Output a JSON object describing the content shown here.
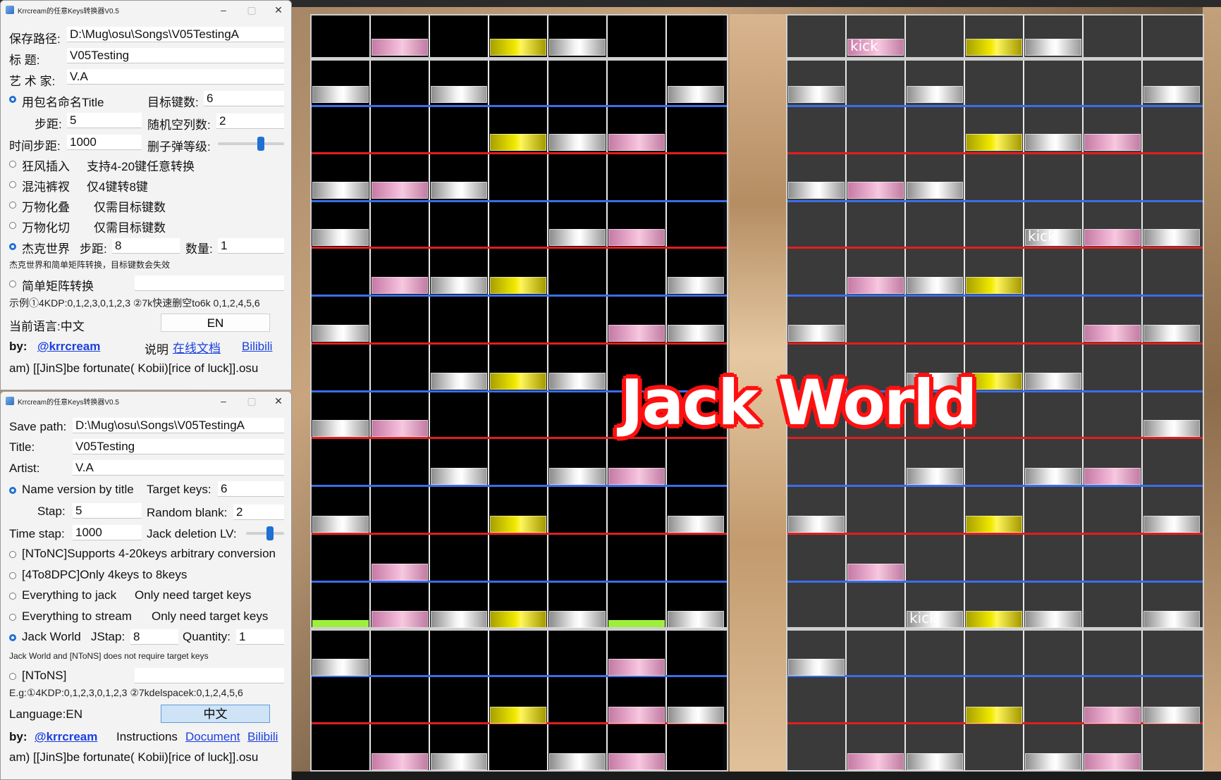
{
  "overlay_text": "Jack World",
  "kick_labels": [
    "kick",
    "kick",
    "kick"
  ],
  "colors": {
    "accent": "#1f6fd4",
    "note_white": "#f4f4f4",
    "note_pink": "#f1b7d6",
    "note_yellow": "#f2ea00",
    "note_green": "#9cf03a",
    "line_blue": "#3a6ee8",
    "line_red": "#e11f1f",
    "overlay_stroke": "#ff1010"
  },
  "cn_window": {
    "title": "Krrcream的任意Keys转换器V0.5",
    "save_path_label": "保存路径:",
    "save_path_value": "D:\\Mug\\osu\\Songs\\V05TestingA",
    "title_label": "标    题:",
    "title_value": "V05Testing",
    "artist_label": "艺 术 家:",
    "artist_value": "V.A",
    "name_by_title": "用包名命名Title",
    "target_keys_label": "目标键数:",
    "target_keys_value": "6",
    "step_label": "步距:",
    "step_value": "5",
    "random_blank_label": "随机空列数:",
    "random_blank_value": "2",
    "time_step_label": "时间步距:",
    "time_step_value": "1000",
    "jack_del_label": "删子弹等级:",
    "opt1": "狂风插入",
    "opt1_desc": "支持4-20键任意转换",
    "opt2": "混沌裤衩",
    "opt2_desc": "仅4键转8键",
    "opt3": "万物化叠",
    "opt3_desc": "仅需目标键数",
    "opt4": "万物化切",
    "opt4_desc": "仅需目标键数",
    "opt5": "杰克世界",
    "jstep_label": "步距:",
    "jstep_value": "8",
    "qty_label": "数量:",
    "qty_value": "1",
    "note_small": "杰克世界和简单矩阵转换，目标键数会失效",
    "opt6": "简单矩阵转换",
    "example": "示例①4KDP:0,1,2,3,0,1,2,3 ②7k快速删空to6k 0,1,2,4,5,6",
    "language": "当前语言:中文",
    "lang_button": "EN",
    "by_label": "by:",
    "author_link": "@krrcream",
    "instr_label": "说明",
    "doc_link": "在线文档",
    "bili_link": "Bilibili",
    "file": "am) [[JinS]be  fortunate(  Kobii)[rice  of  luck]].osu"
  },
  "en_window": {
    "title": "Krrcream的任意Keys转换器V0.5",
    "save_path_label": "Save path:",
    "save_path_value": "D:\\Mug\\osu\\Songs\\V05TestingA",
    "title_label": "Title:",
    "title_value": "V05Testing",
    "artist_label": "Artist:",
    "artist_value": "V.A",
    "name_by_title": "Name version by title",
    "target_keys_label": "Target keys:",
    "target_keys_value": "6",
    "step_label": "Stap:",
    "step_value": "5",
    "random_blank_label": "Random blank:",
    "random_blank_value": "2",
    "time_step_label": "Time stap:",
    "time_step_value": "1000",
    "jack_del_label": "Jack deletion LV:",
    "opt1": "[NToNC]Supports 4-20keys arbitrary conversion",
    "opt2": "[4To8DPC]Only 4keys to 8keys",
    "opt3": "Everything to jack",
    "opt3_desc": "Only need target keys",
    "opt4": "Everything to stream",
    "opt4_desc": "Only need target keys",
    "opt5": "Jack World",
    "jstep_label": "JStap:",
    "jstep_value": "8",
    "qty_label": "Quantity:",
    "qty_value": "1",
    "note_small": "Jack World and [NToNS] does not require target keys",
    "opt6": "[NToNS]",
    "example": "E.g:①4KDP:0,1,2,3,0,1,2,3 ②7kdelspacek:0,1,2,4,5,6",
    "language": "Language:EN",
    "lang_button": "中文",
    "by_label": "by:",
    "author_link": "@krrcream",
    "instr_label": "Instructions",
    "doc_link": "Document",
    "bili_link": "Bilibili",
    "file": "am) [[JinS]be  fortunate(  Kobii)[rice  of  luck]].osu"
  }
}
